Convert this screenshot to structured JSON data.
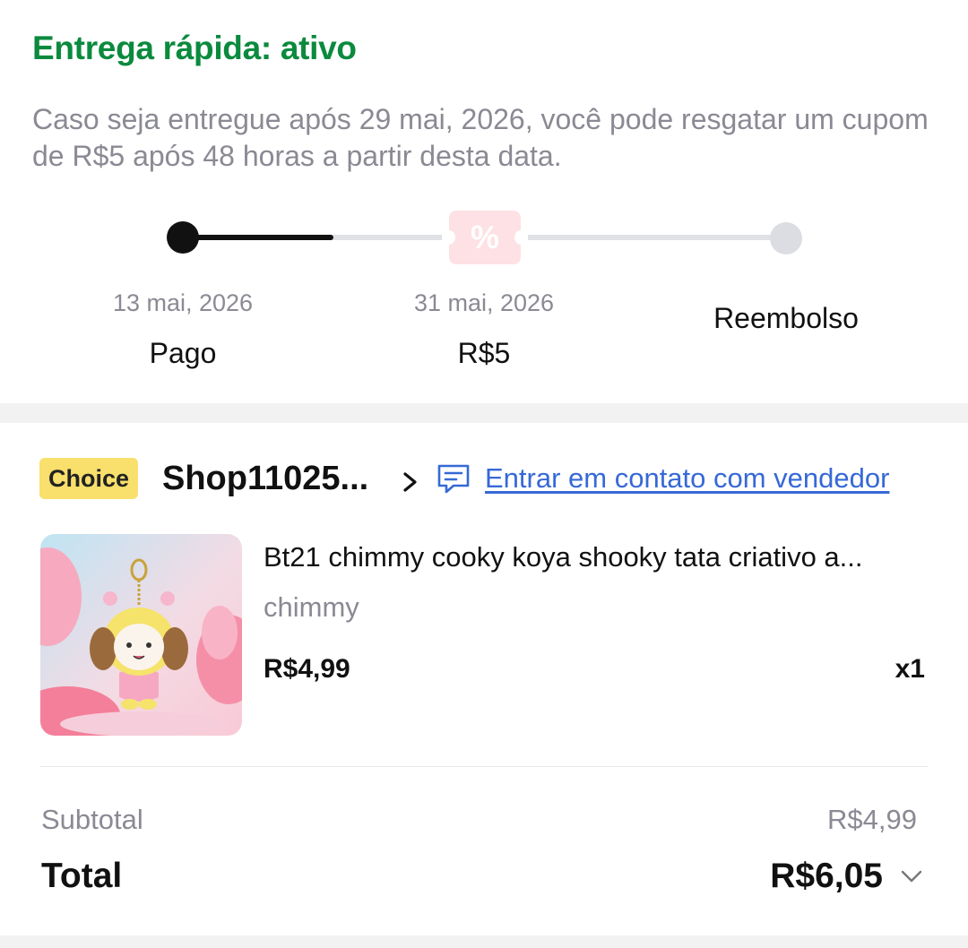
{
  "delivery": {
    "title": "Entrega rápida: ativo",
    "description": "Caso seja entregue após 29 mai, 2026, você pode resgatar um cupom de R$5 após 48 horas a partir desta data."
  },
  "timeline": {
    "progress_fraction": 0.25,
    "steps": [
      {
        "date": "13 mai, 2026",
        "label": "Pago"
      },
      {
        "date": "31 mai, 2026",
        "label": "R$5",
        "icon": "coupon-percent-icon"
      },
      {
        "date": "",
        "label": "Reembolso"
      }
    ]
  },
  "order": {
    "badge": "Choice",
    "shop_name": "Shop11025...",
    "contact_label": "Entrar em contato com vendedor",
    "item": {
      "title": "Bt21 chimmy cooky koya shooky tata criativo a...",
      "variant": "chimmy",
      "price": "R$4,99",
      "quantity": "x1"
    },
    "subtotal_label": "Subtotal",
    "subtotal_value": "R$4,99",
    "total_label": "Total",
    "total_value": "R$6,05"
  },
  "colors": {
    "active_green": "#0b8a3e",
    "link_blue": "#3669d6",
    "choice_yellow": "#f9df6b",
    "muted_gray": "#8a8a94",
    "coupon_pink": "#fde1e4"
  }
}
